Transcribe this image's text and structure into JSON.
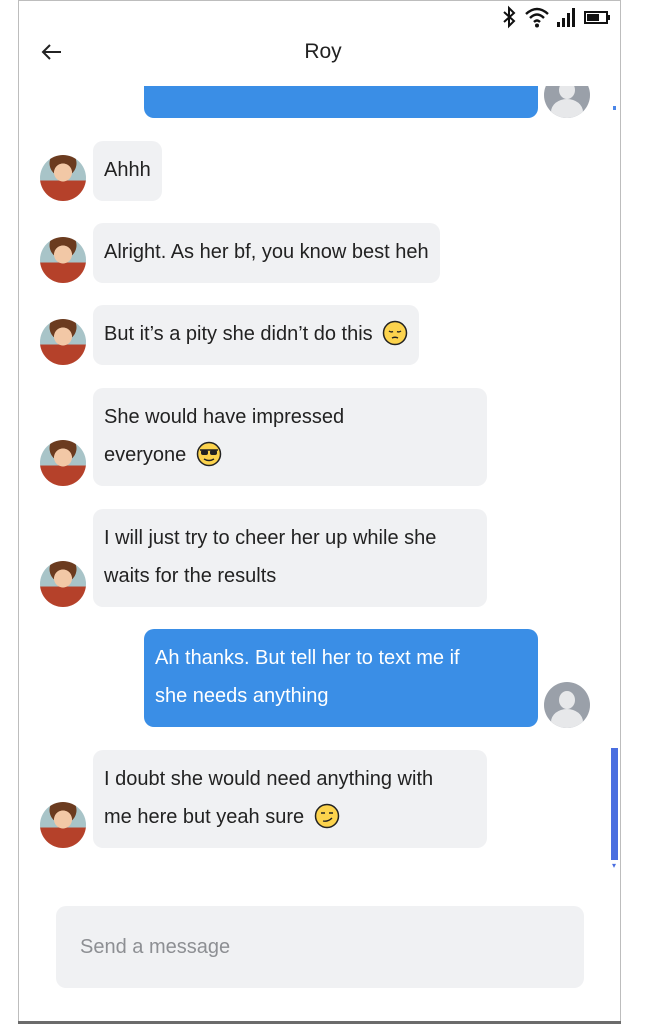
{
  "header": {
    "title": "Roy",
    "back_icon": "arrow-left-icon"
  },
  "status_bar": {
    "icons": [
      "bluetooth-icon",
      "wifi-icon",
      "signal-icon",
      "battery-icon"
    ]
  },
  "messages": [
    {
      "direction": "outgoing",
      "text": ""
    },
    {
      "direction": "incoming",
      "text": "Ahhh"
    },
    {
      "direction": "incoming",
      "text": "Alright. As her bf, you know best heh"
    },
    {
      "direction": "incoming",
      "text": "But it’s a pity she didn’t do this",
      "emoji": "pensive-face-emoji"
    },
    {
      "direction": "incoming",
      "lines": [
        "She would have impressed",
        "everyone"
      ],
      "emoji": "sunglasses-face-emoji"
    },
    {
      "direction": "incoming",
      "lines": [
        "I will just try to cheer her up while she",
        "waits for the results"
      ]
    },
    {
      "direction": "outgoing",
      "lines": [
        "Ah thanks. But tell her to text me if",
        "she needs anything"
      ]
    },
    {
      "direction": "incoming",
      "lines": [
        "I doubt she would need anything with",
        "me here but yeah sure"
      ],
      "emoji": "smirk-face-emoji"
    }
  ],
  "composer": {
    "placeholder": "Send a message"
  },
  "colors": {
    "outgoing_bubble": "#3a8ee6",
    "incoming_bubble": "#f0f1f3",
    "scrollbar": "#4a6ee0"
  }
}
